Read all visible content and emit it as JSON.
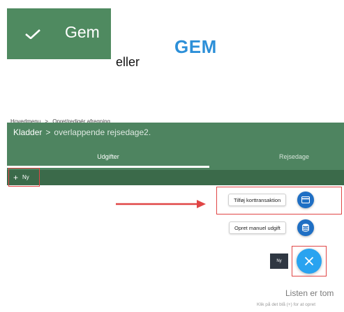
{
  "legend": {
    "green_button_label": "Gem",
    "connector": "eller",
    "text_button_label": "GEM"
  },
  "breadcrumb": [
    "Hovedmenu",
    ">",
    "Opret/redigér afregning"
  ],
  "header": {
    "title": "Kladder",
    "separator": ">",
    "subtitle": "overlappende rejsedage2."
  },
  "tabs": [
    {
      "label": "Udgifter",
      "active": true
    },
    {
      "label": "Rejsedage",
      "active": false
    }
  ],
  "toolbar": {
    "new_label": "Ny",
    "plus": "+"
  },
  "speed_dial": {
    "add_card_transaction": "Tilføj korttransaktion",
    "create_manual_expense": "Opret manuel udgift",
    "tooltip_new": "Ny"
  },
  "empty_state": {
    "title": "Listen er tom",
    "hint": "Klik på det blå (+) for at opret"
  },
  "colors": {
    "header_green": "#4e8460",
    "toolbar_green": "#3b6a4a",
    "fab_blue": "#29a3f0",
    "mini_fab_blue": "#1f6fc4",
    "highlight_red": "#e04545"
  },
  "icons": [
    "check-icon",
    "plus-icon",
    "credit-card-icon",
    "database-icon",
    "close-icon",
    "arrow-right-icon"
  ]
}
